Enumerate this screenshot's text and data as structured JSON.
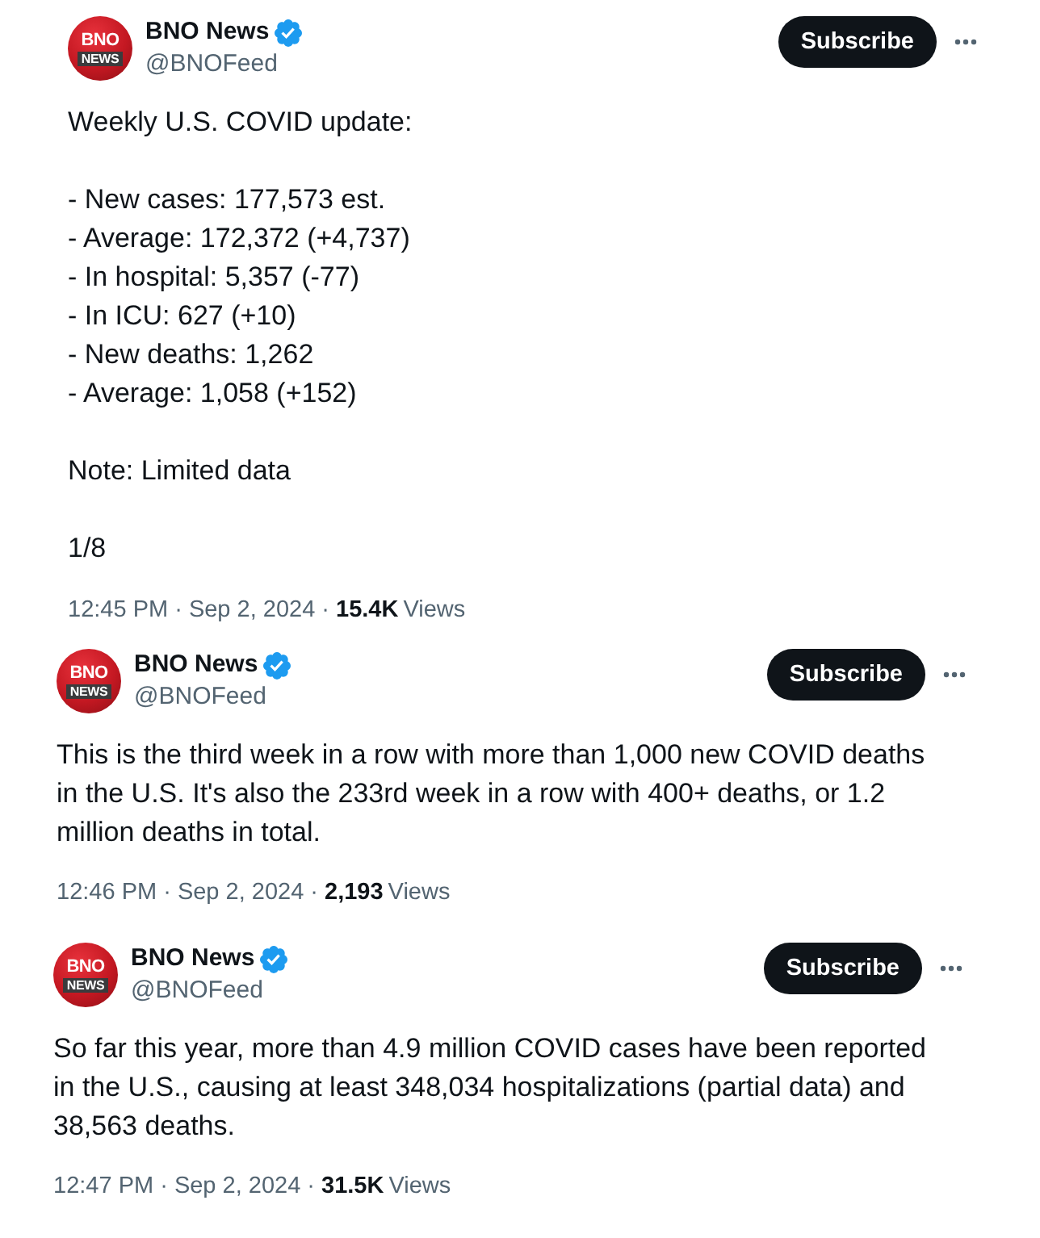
{
  "tweets": [
    {
      "author": {
        "name": "BNO News",
        "handle": "@BNOFeed",
        "verified": true,
        "avatar": {
          "line_1": "BNO",
          "line_2": "NEWS"
        }
      },
      "subscribe_label": "Subscribe",
      "paragraphs": [
        [
          "Weekly U.S. COVID update:"
        ],
        [
          "- New cases: 177,573 est.",
          "- Average: 172,372 (+4,737)",
          "- In hospital: 5,357 (-77)",
          "- In ICU: 627 (+10)",
          "- New deaths: 1,262",
          "- Average: 1,058 (+152)"
        ],
        [
          "Note: Limited data"
        ],
        [
          "1/8"
        ]
      ],
      "timestamp": "12:45 PM · Sep 2, 2024",
      "separator": "·",
      "views_count": "15.4K",
      "views_label": "Views"
    },
    {
      "author": {
        "name": "BNO News",
        "handle": "@BNOFeed",
        "verified": true,
        "avatar": {
          "line_1": "BNO",
          "line_2": "NEWS"
        }
      },
      "subscribe_label": "Subscribe",
      "paragraphs": [
        [
          "This is the third week in a row with more than 1,000 new COVID deaths in the U.S. It's also the 233rd week in a row with 400+ deaths, or 1.2 million deaths in total."
        ]
      ],
      "timestamp": "12:46 PM · Sep 2, 2024",
      "separator": "·",
      "views_count": "2,193",
      "views_label": "Views"
    },
    {
      "author": {
        "name": "BNO News",
        "handle": "@BNOFeed",
        "verified": true,
        "avatar": {
          "line_1": "BNO",
          "line_2": "NEWS"
        }
      },
      "subscribe_label": "Subscribe",
      "paragraphs": [
        [
          "So far this year, more than 4.9 million COVID cases have been reported in the U.S., causing at least 348,034 hospitalizations (partial data) and 38,563 deaths."
        ]
      ],
      "timestamp": "12:47 PM · Sep 2, 2024",
      "separator": "·",
      "views_count": "31.5K",
      "views_label": "Views"
    }
  ]
}
